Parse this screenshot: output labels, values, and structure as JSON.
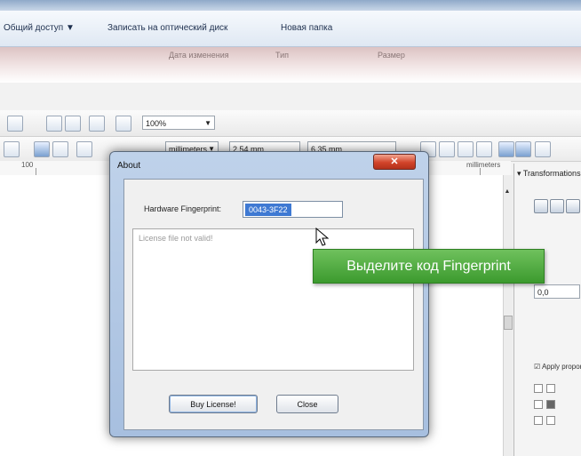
{
  "explorer": {
    "toolbar_items": [
      "Общий доступ ▼",
      "Записать на оптический диск",
      "Новая папка"
    ],
    "column_headers": [
      "Дата изменения",
      "Тип",
      "Размер"
    ]
  },
  "toolbar": {
    "zoom_value": "100%",
    "units_value": "millimeters",
    "nudge_value": "2,54 mm",
    "duplicate_value": "6,35 mm"
  },
  "ruler": {
    "label_left": "100",
    "label_right": "millimeters"
  },
  "docker": {
    "title": "Transformations",
    "x_value": "0,0",
    "checkbox_label": "Apply proportionally"
  },
  "dialog": {
    "title": "About",
    "close_glyph": "✕",
    "fingerprint_label": "Hardware Fingerprint:",
    "fingerprint_value": "0043-3F22",
    "license_message": "License file not valid!",
    "buy_button": "Buy License!",
    "close_button": "Close"
  },
  "callout": {
    "text": "Выделите код Fingerprint",
    "color": "#4aa73a"
  },
  "colors": {
    "dialog_frame": "#a7bfdf",
    "selection": "#3e79d3",
    "close_button": "#d2442a"
  }
}
